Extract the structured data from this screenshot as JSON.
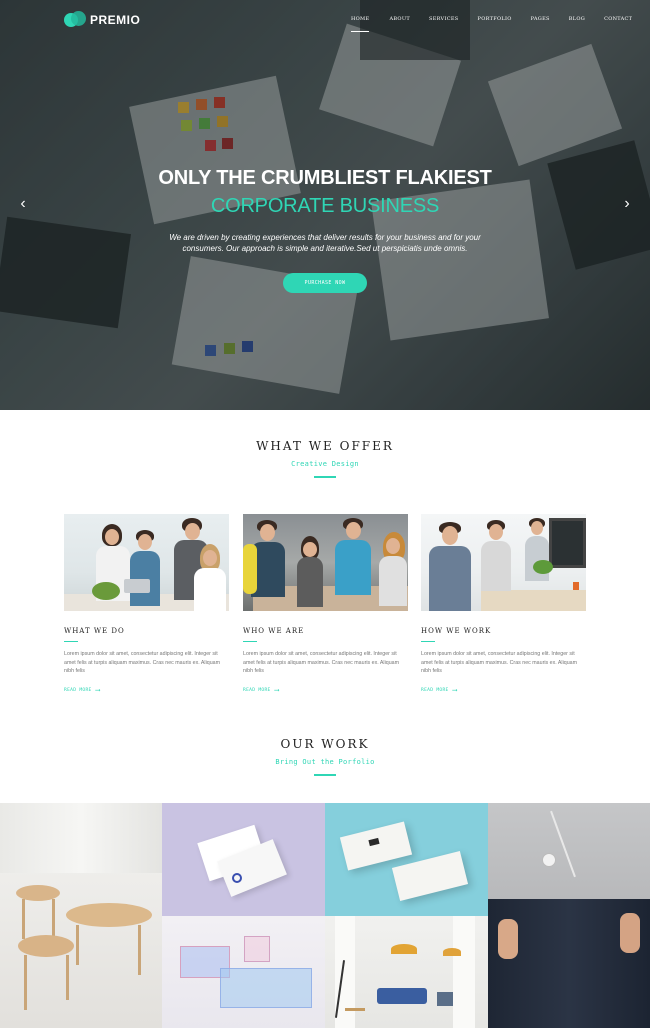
{
  "brand": {
    "name": "PREMIO",
    "accent": "#2fd6b5"
  },
  "nav": {
    "items": [
      {
        "label": "HOME",
        "active": true
      },
      {
        "label": "ABOUT"
      },
      {
        "label": "SERVICES"
      },
      {
        "label": "PORTFOLIO"
      },
      {
        "label": "PAGES"
      },
      {
        "label": "BLOG"
      },
      {
        "label": "CONTACT"
      }
    ]
  },
  "hero": {
    "title_line1": "ONLY THE CRUMBLIEST FLAKIEST",
    "title_line2": "CORPORATE BUSINESS",
    "description": "We are driven by creating experiences that deliver results for your business and for your consumers. Our approach is simple and iterative.Sed ut perspiciatis unde omnis.",
    "button_label": "PURCHASE NOW",
    "prev_icon": "chevron-left-icon",
    "next_icon": "chevron-right-icon"
  },
  "offer": {
    "title": "WHAT WE OFFER",
    "subtitle": "Creative Design",
    "cards": [
      {
        "title": "WHAT WE DO",
        "text": "Lorem ipsum dolor sit amet, consectetur adipiscing elit. Integer sit amet felis at turpis aliquam maximus. Cras nec mauris ex. Aliquam nibh felis",
        "link": "READ MORE"
      },
      {
        "title": "WHO WE ARE",
        "text": "Lorem ipsum dolor sit amet, consectetur adipiscing elit. Integer sit amet felis at turpis aliquam maximus. Cras nec mauris ex. Aliquam nibh felis",
        "link": "READ MORE"
      },
      {
        "title": "HOW WE WORK",
        "text": "Lorem ipsum dolor sit amet, consectetur adipiscing elit. Integer sit amet felis at turpis aliquam maximus. Cras nec mauris ex. Aliquam nibh felis",
        "link": "READ MORE"
      }
    ]
  },
  "work": {
    "title": "OUR WORK",
    "subtitle": "Bring Out the Porfolio"
  }
}
